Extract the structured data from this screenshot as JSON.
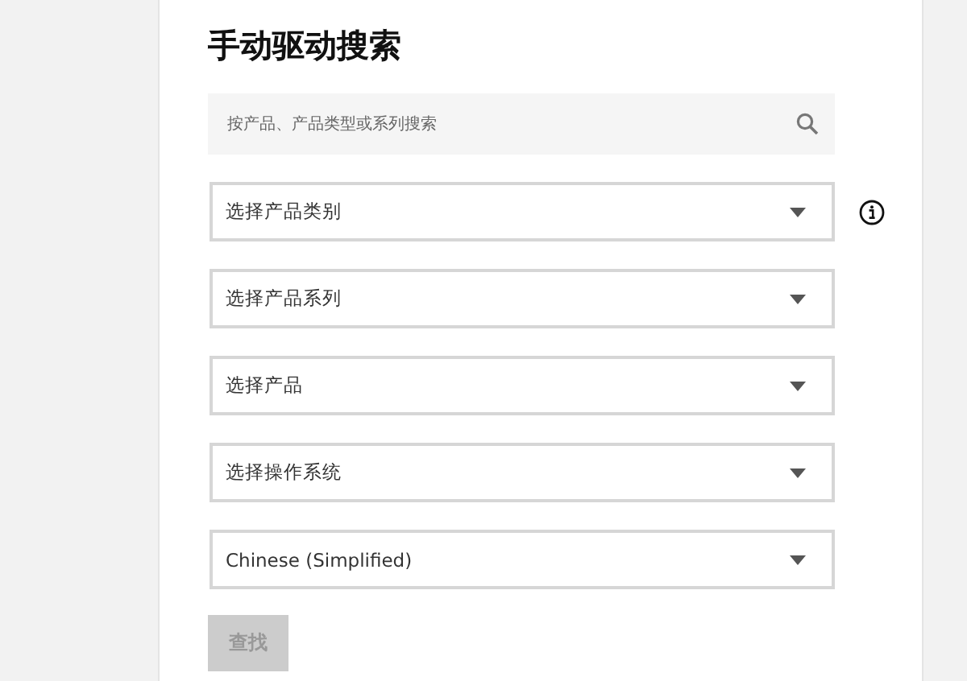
{
  "title": "手动驱动搜索",
  "search": {
    "placeholder": "按产品、产品类型或系列搜索"
  },
  "dropdowns": [
    {
      "value": "选择产品类别",
      "info": true
    },
    {
      "value": "选择产品系列",
      "info": false
    },
    {
      "value": "选择产品",
      "info": false
    },
    {
      "value": "选择操作系统",
      "info": false
    },
    {
      "value": "Chinese (Simplified)",
      "info": false
    }
  ],
  "button": {
    "label": "查找",
    "disabled": true
  }
}
